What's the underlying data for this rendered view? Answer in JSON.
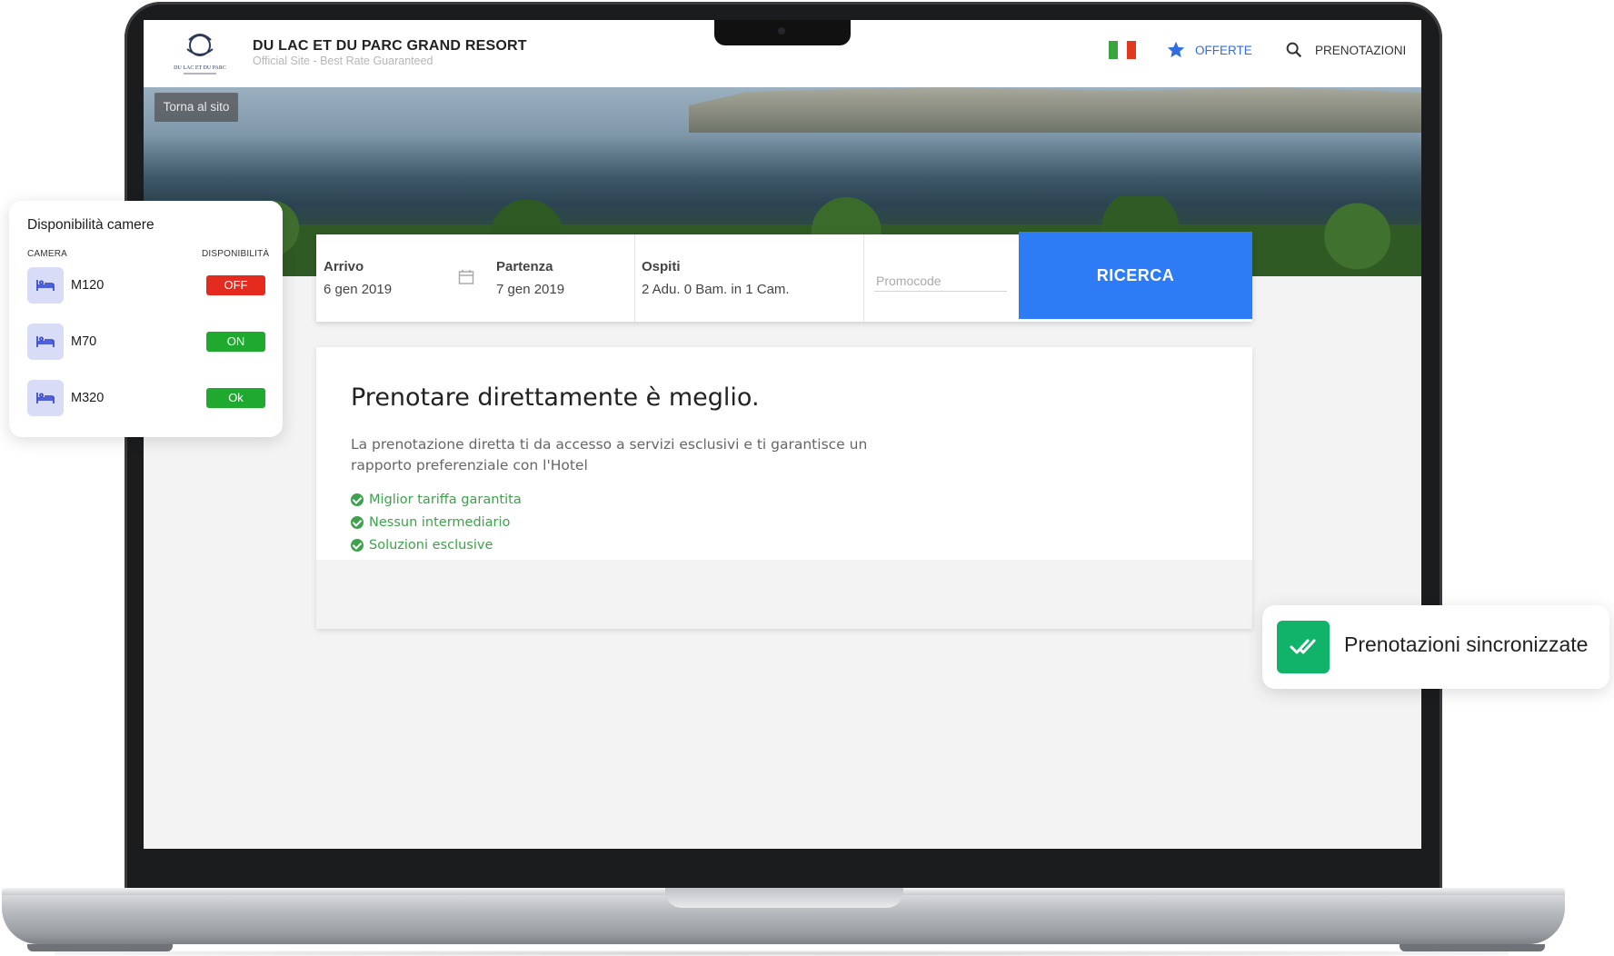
{
  "site": {
    "brand_title": "DU LAC ET DU PARC GRAND RESORT",
    "brand_subtitle": "Official Site - Best Rate Guaranteed",
    "logo_text": "DU LAC ET DU PARC",
    "back_label": "Torna al sito",
    "nav": {
      "offerte": "OFFERTE",
      "prenotazioni": "PRENOTAZIONI"
    },
    "flag_colors": [
      "#3aa53a",
      "#ffffff",
      "#e03a1e"
    ]
  },
  "search": {
    "arrivo_label": "Arrivo",
    "arrivo_value": "6 gen 2019",
    "partenza_label": "Partenza",
    "partenza_value": "7 gen 2019",
    "ospiti_label": "Ospiti",
    "ospiti_value": "2 Adu. 0 Bam. in 1 Cam.",
    "promocode_placeholder": "Promocode",
    "search_button": "RICERCA"
  },
  "promo": {
    "title": "Prenotare direttamente è meglio.",
    "text": "La prenotazione diretta ti da accesso a servizi esclusivi e ti garantisce un rapporto preferenziale con l'Hotel",
    "bullets": [
      "Miglior tariffa garantita",
      "Nessun intermediario",
      "Soluzioni esclusive"
    ]
  },
  "availability": {
    "title": "Disponibilità camere",
    "col_camera": "CAMERA",
    "col_disponibilita": "DISPONIBILITÀ",
    "rooms": [
      {
        "name": "M120",
        "status": "OFF",
        "color": "#e52b1f"
      },
      {
        "name": "M70",
        "status": "ON",
        "color": "#1faa2f"
      },
      {
        "name": "M320",
        "status": "Ok",
        "color": "#1faa2f"
      }
    ]
  },
  "sync": {
    "label": "Prenotazioni sincronizzate",
    "icon": "double-check-icon"
  },
  "colors": {
    "accent_blue": "#2d7cf6",
    "success_green": "#11b36a"
  }
}
